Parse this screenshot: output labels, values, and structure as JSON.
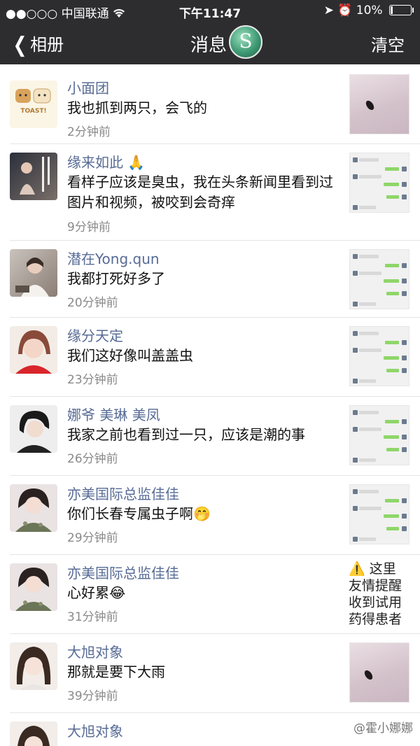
{
  "status_bar": {
    "signal": "●●○○○",
    "carrier": "中国联通",
    "wifi_icon": "wifi-icon",
    "time": "下午11:47",
    "battery": "10%"
  },
  "nav": {
    "back_label": "相册",
    "title": "消息",
    "logo_letter": "S",
    "clear_label": "清空"
  },
  "messages": [
    {
      "name": "小面团",
      "text": "我也抓到两只，会飞的",
      "time": "2分钟前",
      "thumb": "bug-photo"
    },
    {
      "name": "缘来如此 🙏",
      "text": "看样子应该是臭虫，我在头条新闻里看到过图片和视频，被咬到会奇痒",
      "time": "9分钟前",
      "thumb": "chat-screenshot"
    },
    {
      "name": "潜在Yong.qun",
      "text": "我都打死好多了",
      "time": "20分钟前",
      "thumb": "chat-screenshot"
    },
    {
      "name": "缘分天定",
      "text": "我们这好像叫盖盖虫",
      "time": "23分钟前",
      "thumb": "chat-screenshot"
    },
    {
      "name": "娜爷 美琳 美凤",
      "text": "我家之前也看到过一只，应该是潮的事",
      "time": "26分钟前",
      "thumb": "chat-screenshot"
    },
    {
      "name": "亦美国际总监佳佳",
      "text": "你们长春专属虫子啊🤭",
      "time": "29分钟前",
      "thumb": "chat-screenshot"
    },
    {
      "name": "亦美国际总监佳佳",
      "text": "心好累😂",
      "time": "31分钟前",
      "thumb": "text-note"
    },
    {
      "name": "大旭对象",
      "text": "那就是要下大雨",
      "time": "39分钟前",
      "thumb": "bug-photo"
    },
    {
      "name": "大旭对象",
      "text": "",
      "time": "",
      "thumb": "none"
    }
  ],
  "side_note": {
    "icon": "⚠️",
    "line1": "这里",
    "line2": "友情提醒",
    "line3": "收到试用",
    "line4": "药得患者"
  },
  "watermark": "@霍小娜娜",
  "colors": {
    "bar_bg": "#2d2d2f",
    "name_blue": "#576b95",
    "time_gray": "#8a8a8a"
  }
}
